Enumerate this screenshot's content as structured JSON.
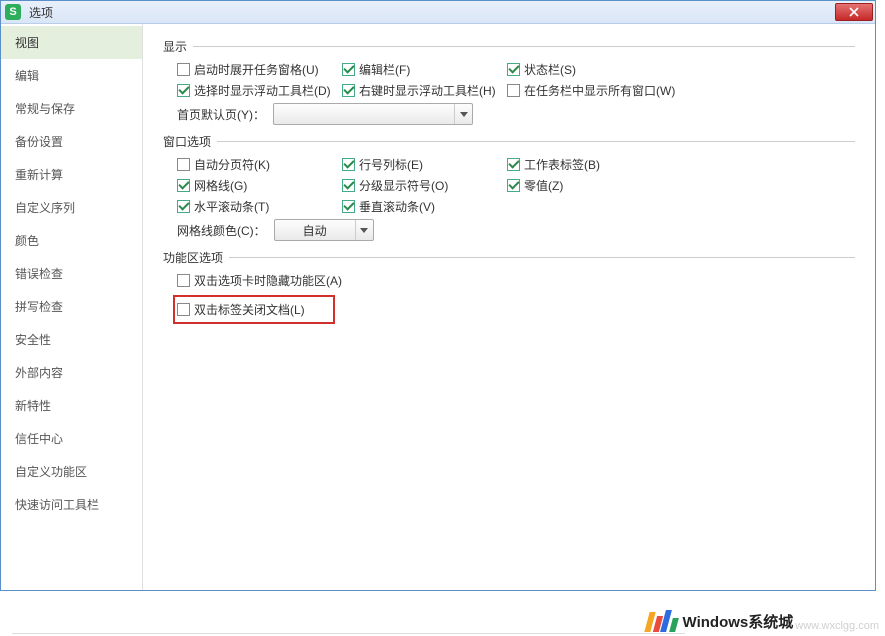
{
  "window": {
    "title": "选项",
    "app_icon_letter": "S"
  },
  "sidebar": {
    "items": [
      {
        "label": "视图",
        "active": true
      },
      {
        "label": "编辑"
      },
      {
        "label": "常规与保存"
      },
      {
        "label": "备份设置"
      },
      {
        "label": "重新计算"
      },
      {
        "label": "自定义序列"
      },
      {
        "label": "颜色"
      },
      {
        "label": "错误检查"
      },
      {
        "label": "拼写检查"
      },
      {
        "label": "安全性"
      },
      {
        "label": "外部内容"
      },
      {
        "label": "新特性"
      },
      {
        "label": "信任中心"
      },
      {
        "label": "自定义功能区"
      },
      {
        "label": "快速访问工具栏"
      }
    ]
  },
  "groups": {
    "display": {
      "title": "显示",
      "startup_taskpane": {
        "label": "启动时展开任务窗格(U)",
        "checked": false
      },
      "edit_bar": {
        "label": "编辑栏(F)",
        "checked": true
      },
      "status_bar": {
        "label": "状态栏(S)",
        "checked": true
      },
      "select_float_toolbar": {
        "label": "选择时显示浮动工具栏(D)",
        "checked": true
      },
      "rightclick_float_toolbar": {
        "label": "右键时显示浮动工具栏(H)",
        "checked": true
      },
      "show_all_windows_taskbar": {
        "label": "在任务栏中显示所有窗口(W)",
        "checked": false
      },
      "default_page_label": "首页默认页(Y)：",
      "default_page_value": ""
    },
    "window_options": {
      "title": "窗口选项",
      "auto_pagebreak": {
        "label": "自动分页符(K)",
        "checked": false
      },
      "row_col_header": {
        "label": "行号列标(E)",
        "checked": true
      },
      "sheet_tabs": {
        "label": "工作表标签(B)",
        "checked": true
      },
      "gridlines": {
        "label": "网格线(G)",
        "checked": true
      },
      "outline_symbols": {
        "label": "分级显示符号(O)",
        "checked": true
      },
      "zero_values": {
        "label": "零值(Z)",
        "checked": true
      },
      "h_scrollbar": {
        "label": "水平滚动条(T)",
        "checked": true
      },
      "v_scrollbar": {
        "label": "垂直滚动条(V)",
        "checked": true
      },
      "grid_color_label": "网格线颜色(C)：",
      "grid_color_value": "自动"
    },
    "ribbon_options": {
      "title": "功能区选项",
      "dblclick_hide_ribbon": {
        "label": "双击选项卡时隐藏功能区(A)",
        "checked": false
      },
      "dblclick_close_doc": {
        "label": "双击标签关闭文档(L)",
        "checked": false
      }
    }
  },
  "watermark": {
    "text": "Windows系统城",
    "url": "www.wxclgg.com"
  }
}
